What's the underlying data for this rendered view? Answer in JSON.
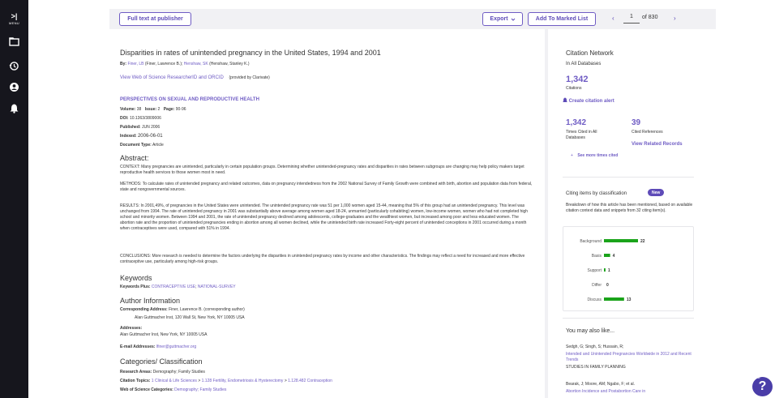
{
  "sidebar": {
    "menu_glyph": ">|",
    "menu_label": "MENU",
    "icons": [
      "folder-icon",
      "history-icon",
      "user-icon",
      "bell-icon"
    ]
  },
  "toolbar": {
    "full_text_label": "Full text at publisher",
    "export_label": "Export",
    "add_marked_label": "Add To Marked List",
    "prev_symbol": "‹",
    "next_symbol": "›",
    "page_value": "1",
    "page_of": "of 830"
  },
  "article": {
    "title": "Disparities in rates of unintended pregnancy in the United States, 1994 and 2001",
    "by_label": "By:",
    "author1": "Finer, LB",
    "author1_full": "(Finer, Lawrence B.)",
    "author_sep": ";",
    "author2": "Henshaw, SK",
    "author2_full": "(Henshaw, Stanley K.)",
    "researcher_link": "View Web of Science ResearcherID and ORCID",
    "provided_by": "(provided by Clarivate)",
    "journal": "PERSPECTIVES ON SEXUAL AND REPRODUCTIVE HEALTH",
    "volume_label": "Volume:",
    "volume": "38",
    "issue_label": "Issue:",
    "issue": "2",
    "page_label": "Page:",
    "pages": "90-96",
    "doi_label": "DOI:",
    "doi": "10.1363/3809006",
    "published_label": "Published:",
    "published": "JUN 2006",
    "indexed_label": "Indexed:",
    "indexed": "2006-06-01",
    "doctype_label": "Document Type:",
    "doctype": "Article"
  },
  "abstract": {
    "heading": "Abstract:",
    "p1": "CONTEXT: Many pregnancies are unintended, particularly in certain population groups. Determining whether unintended-pregnancy rates and disparities in rates between subgroups are changing may help policy makers target reproductive health services to those women most in need.",
    "p2": "METHODS: To calculate rates of unintended pregnancy and related outcomes, data on pregnancy intendedness from the 2002 National Survey of Family Growth were combined with birth, abortion and population data from federal, state and nongovernmental sources.",
    "p3": "RESULTS: In 2001,49%, of pregnancies in the United States were unintended. The unintended pregnancy rate was 51 per 1,000 women aged 15-44, meaning that 5% of this group had an unintended pregnancy. This level was unchanged from 1994. The rate of unintended pregnancy in 2001 was substantially above average among women aged 18-24, unmarried (particularly cohabiting) women, low-income women, women who had not completed high school and minority women. Between 1994 and 2001, the rate of unintended pregnancy declined among adolescents, college-graduates and the wealthiest women, but increased among poor and less educated women. The abortion rate and the proportion of unintended pregnancies ending in abortion among all women declined, while the unintended birth rate increased Forty-eight percent of unintended conceptions in 2001 occurred during a month when contraceptives were used, compared with 51% in 1994.",
    "p4": "CONCLUSIONS: More research is needed to determine the factors underlying the disparities in unintended pregnancy rates by income and other characteristics. The findings may reflect a need for increased and more effective contraceptive use, particularly among high-risk groups."
  },
  "keywords": {
    "heading": "Keywords",
    "plus_label": "Keywords Plus:",
    "kw1": "CONTRACEPTIVE USE",
    "sep": ";",
    "kw2": "NATIONAL-SURVEY"
  },
  "author_info": {
    "heading": "Author Information",
    "corr_label": "Corresponding Address:",
    "corr_name": "Finer, Lawrence B.",
    "corr_note": "(corresponding author)",
    "corr_addr": "Alan Guttmacher Inst, 120 Wall St, New York, NY 10005 USA",
    "addresses_label": "Addresses:",
    "address1": "Alan Guttmacher Inst, New York, NY 10005 USA",
    "email_label": "E-mail Addresses:",
    "email": "lfiner@guttmacher.org"
  },
  "classification": {
    "heading": "Categories/ Classification",
    "areas_label": "Research Areas:",
    "areas": "Demography; Family Studies",
    "topics_label": "Citation Topics:",
    "topic1": "1 Clinical & Life Sciences",
    "topic_sep": ">",
    "topic2": "1.128 Fertility, Endometriosis & Hysterectomy",
    "topic3": "1.128.482 Contraception",
    "wos_label": "Web of Science Categories:",
    "wos": "Demography; Family Studies"
  },
  "citation_network": {
    "heading": "Citation Network",
    "scope": "In All Databases",
    "citations_count": "1,342",
    "citations_label": "Citations",
    "alert_label": "Create citation alert",
    "times_cited": "1,342",
    "times_cited_label": "Times Cited in All Databases",
    "cited_refs": "39",
    "cited_refs_label": "Cited References",
    "related_label": "View Related Records",
    "more_cited_label": "See more times cited"
  },
  "citing": {
    "heading": "Citing items by classification",
    "badge": "New",
    "description": "Breakdown of how this article has been mentioned, based on available citation context data and snippets from 32 citing item(s).",
    "items": [
      {
        "label": "Background",
        "value": 22
      },
      {
        "label": "Basis",
        "value": 4
      },
      {
        "label": "Support",
        "value": 1
      },
      {
        "label": "Differ",
        "value": 0
      },
      {
        "label": "Discuss",
        "value": 13
      }
    ],
    "bar_color": "#1aa31a"
  },
  "also_like": {
    "heading": "You may also like...",
    "r1_authors": "Sedgh, G; Singh, S; Hussain, R;",
    "r1_title": "Intended and Unintended Pregnancies Worldwide in 2012 and Recent Trends",
    "r1_journal": "STUDIES IN FAMILY PLANNING",
    "r2_authors": "Bearak, J; Moore, AM; Ngabo, F; et al.",
    "r2_title": "Abortion Incidence and Postabortion Care in"
  },
  "help": {
    "count": "18",
    "glyph": "?"
  },
  "colors": {
    "accent": "#5e4bb8",
    "link": "#6f5cc4",
    "sidebar": "#16161d",
    "panel": "#f1f1f4"
  }
}
